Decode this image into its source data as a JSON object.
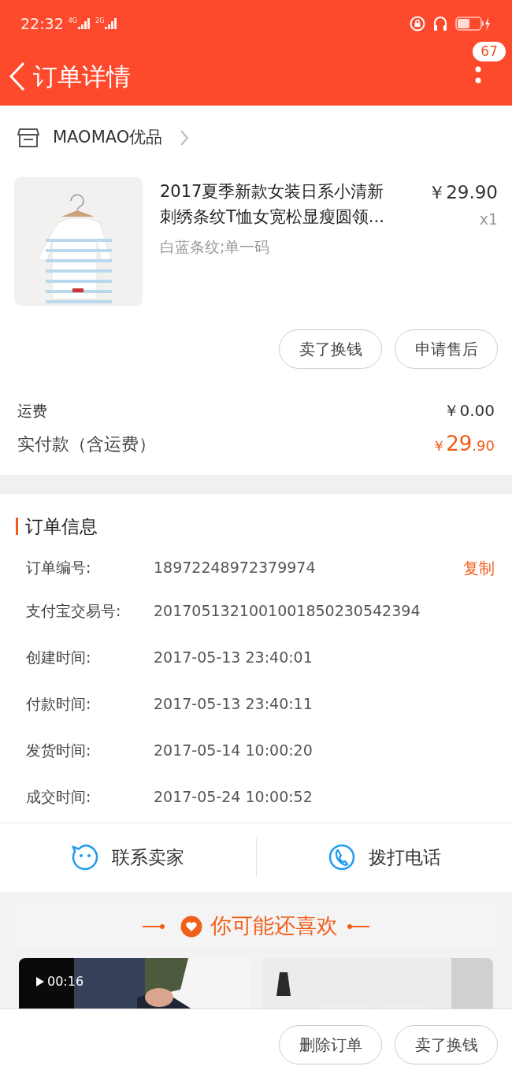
{
  "status_bar": {
    "time": "22:32",
    "networks": [
      "4G",
      "2G"
    ]
  },
  "header": {
    "title": "订单详情",
    "badge": "67"
  },
  "shop": {
    "name": "MAOMAO优品"
  },
  "product": {
    "image": {
      "kind": "picture"
    },
    "title": "2017夏季新款女装日系小清新刺绣条纹T恤女宽松显瘦圆领...",
    "price": "￥29.90",
    "quantity": "x1",
    "variant": "白蓝条纹;单一码",
    "actions": [
      "卖了换钱",
      "申请售后"
    ]
  },
  "fees": [
    {
      "label": "运费",
      "value": "￥0.00",
      "kind": "plain"
    },
    {
      "label": "实付款（含运费）",
      "value": "￥**29**.90",
      "kind": "total"
    }
  ],
  "order_info": {
    "title": "订单信息",
    "rows": [
      {
        "label": "订单编号:",
        "value": "18972248972379974",
        "action": "复制"
      },
      {
        "label": "支付宝交易号:",
        "value": "2017051321001001850230542394"
      },
      {
        "label": "创建时间:",
        "value": "2017-05-13 23:40:01"
      },
      {
        "label": "付款时间:",
        "value": "2017-05-13 23:40:11"
      },
      {
        "label": "发货时间:",
        "value": "2017-05-14 10:00:20"
      },
      {
        "label": "成交时间:",
        "value": "2017-05-24 10:00:52"
      }
    ]
  },
  "contact": [
    {
      "label": "联系卖家",
      "kind": "chat"
    },
    {
      "label": "拨打电话",
      "kind": "phone"
    }
  ],
  "recommend": {
    "title": "你可能还喜欢",
    "items": [
      {
        "kind": "video",
        "duration": "00:16"
      },
      {
        "kind": "picture"
      }
    ]
  },
  "bottom_actions": [
    "删除订单",
    "卖了换钱"
  ]
}
